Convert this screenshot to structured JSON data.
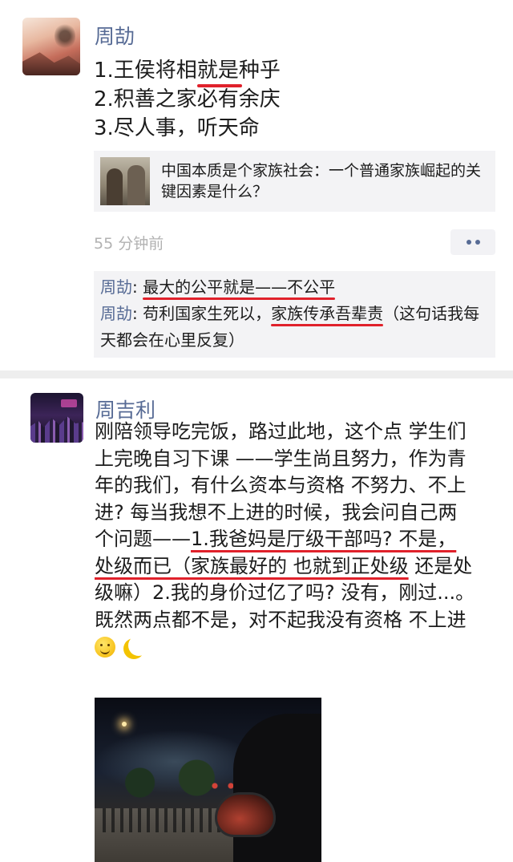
{
  "post1": {
    "author": "周劼",
    "lines": [
      {
        "pre": "1.王侯将相",
        "mark": "就是",
        "post": "种乎"
      },
      {
        "pre": "2.积善之家必有余庆",
        "mark": "",
        "post": ""
      },
      {
        "pre": "3.尽人事，听天命",
        "mark": "",
        "post": ""
      }
    ],
    "link_card": {
      "title": "中国本质是个家族社会：一个普通家族崛起的关键因素是什么？"
    },
    "time": "55 分钟前",
    "comments": [
      {
        "name": "周劼",
        "sep": ": ",
        "text_marked": "最大的公平就是——不公平",
        "text_rest": ""
      },
      {
        "name": "周劼",
        "sep": ": ",
        "text_pre": "苟利国家生死以，",
        "text_marked": "家族传承吾辈责",
        "text_rest": "（这句话我每天都会在心里反复）"
      }
    ]
  },
  "post2": {
    "author": "周吉利",
    "body_a": "刚陪领导吃完饭，路过此地，这个点 学生们上完晚自习下课 ——学生尚且努力，作为青年的我们，有什么资本与资格 不努力、不上进? 每当我想不上进的时候，我会问自己两个问题——",
    "body_m1": "1.我爸妈是厅级干部吗? 不是，处级而已（家族最好的 也就到正处级",
    "body_b": " 还是处级嘛）2.我的身价过亿了吗? 没有，刚过...。既然两点都不是，对不起我没有资格 不上进"
  },
  "icons": {
    "emoji1": "smiling-face-icon",
    "emoji2": "crescent-moon-icon",
    "more": "more-dots-icon"
  },
  "colors": {
    "name_link": "#576b95",
    "underline": "#e0212b",
    "card_bg": "#f3f3f5",
    "time": "#b2b2b2"
  }
}
